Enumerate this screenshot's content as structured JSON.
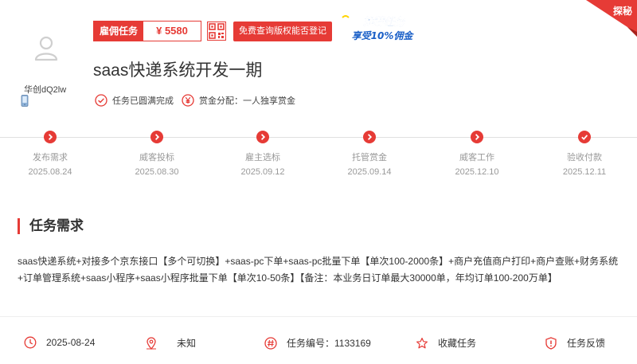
{
  "user": {
    "name": "华创dQ2lw",
    "avatar_icon": "user-icon",
    "phone_icon": "mobile-phone-icon"
  },
  "reward": {
    "label": "雇佣任务",
    "amount": "¥ 5580"
  },
  "qr_icon": "qr-code-icon",
  "free_check_button": "免费查询版权能否登记",
  "promo": {
    "line1": "推荐任务",
    "line2": "享受10%佣金"
  },
  "corner_badge": "探秘",
  "task_title": "saas快递系统开发一期",
  "meta": {
    "status": "任务已圆满完成",
    "reward_split": "赏金分配：一人独享赏金"
  },
  "timeline": [
    {
      "name": "发布需求",
      "date": "2025.08.24",
      "icon": "chevron-right-icon"
    },
    {
      "name": "威客投标",
      "date": "2025.08.30",
      "icon": "chevron-right-icon"
    },
    {
      "name": "雇主选标",
      "date": "2025.09.12",
      "icon": "chevron-right-icon"
    },
    {
      "name": "托管赏金",
      "date": "2025.09.14",
      "icon": "chevron-right-icon"
    },
    {
      "name": "威客工作",
      "date": "2025.12.10",
      "icon": "chevron-right-icon"
    },
    {
      "name": "验收付款",
      "date": "2025.12.11",
      "icon": "check-icon"
    }
  ],
  "section_title": "任务需求",
  "description": "saas快递系统+对接多个京东接口【多个可切换】+saas-pc下单+saas-pc批量下单【单次100-2000条】+商户充值商户打印+商户查账+财务系统+订单管理系统+saas小程序+saas小程序批量下单【单次10-50条】【备注：本业务日订单最大30000单，年均订单100-200万单】",
  "footer": {
    "date": "2025-08-24",
    "location": "未知",
    "task_number": "任务编号：1133169",
    "favorite": "收藏任务",
    "feedback": "任务反馈"
  },
  "colors": {
    "accent": "#e63b36",
    "promo_blue": "#1a5fc7",
    "promo_yellow": "#ffd400"
  }
}
